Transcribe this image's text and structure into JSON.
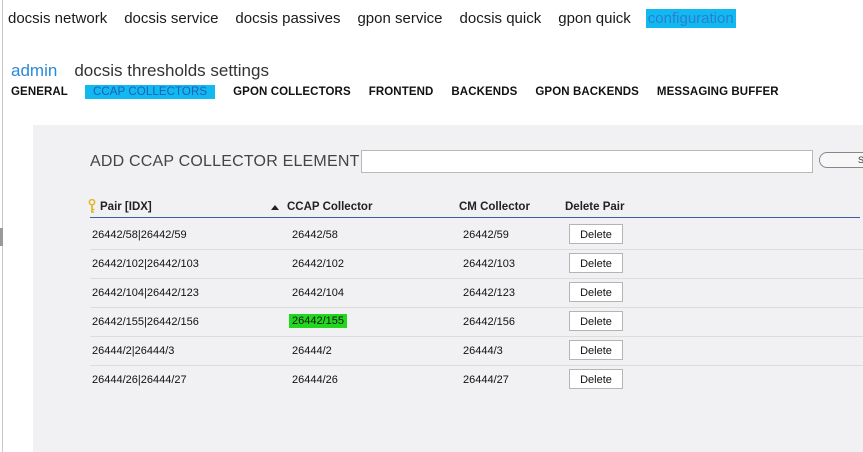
{
  "top_nav": {
    "items": [
      {
        "label": "docsis network"
      },
      {
        "label": "docsis service"
      },
      {
        "label": "docsis passives"
      },
      {
        "label": "gpon service"
      },
      {
        "label": "docsis quick"
      },
      {
        "label": "gpon quick"
      },
      {
        "label": "configuration",
        "active": true
      }
    ]
  },
  "subheader": {
    "admin_label": "admin",
    "title": "docsis thresholds settings"
  },
  "tabs": [
    {
      "label": "GENERAL"
    },
    {
      "label": "CCAP COLLECTORS",
      "active": true
    },
    {
      "label": "GPON COLLECTORS"
    },
    {
      "label": "FRONTEND"
    },
    {
      "label": "BACKENDS"
    },
    {
      "label": "GPON BACKENDS"
    },
    {
      "label": "MESSAGING BUFFER"
    }
  ],
  "add_element": {
    "title": "ADD CCAP COLLECTOR ELEMENT",
    "input_value": "",
    "save_label": "S"
  },
  "table": {
    "headers": [
      "Pair [IDX]",
      "CCAP Collector",
      "CM Collector",
      "Delete Pair"
    ],
    "delete_label": "Delete",
    "rows": [
      {
        "pair": "26442/58|26442/59",
        "ccap": "26442/58",
        "cm": "26442/59"
      },
      {
        "pair": "26442/102|26442/103",
        "ccap": "26442/102",
        "cm": "26442/103"
      },
      {
        "pair": "26442/104|26442/123",
        "ccap": "26442/104",
        "cm": "26442/123"
      },
      {
        "pair": "26442/155|26442/156",
        "ccap": "26442/155",
        "cm": "26442/156",
        "highlight": true
      },
      {
        "pair": "26444/2|26444/3",
        "ccap": "26444/2",
        "cm": "26444/3"
      },
      {
        "pair": "26444/26|26444/27",
        "ccap": "26444/26",
        "cm": "26444/27"
      }
    ]
  },
  "colors": {
    "highlight_blue": "#12b8f0",
    "highlight_green": "#22d81e",
    "link_blue": "#2a8ad8",
    "panel_bg": "#f1f1f3"
  }
}
